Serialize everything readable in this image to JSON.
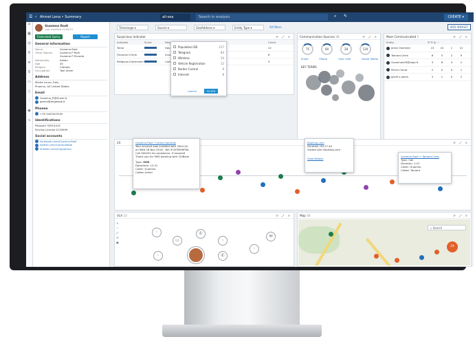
{
  "topbar": {
    "title": "Ahmet Lena • Summary",
    "scope": "all-sea",
    "search_placeholder": "Search in analysis",
    "create_label": "CREATE"
  },
  "profile": {
    "name": "Guamno Rodi",
    "sub": "Last modified 31/05/19",
    "btn_federated": "Federated Query",
    "btn_report": "Report",
    "general_title": "General information",
    "fields": [
      [
        "Name",
        "Guamno Rodi"
      ],
      [
        "Other Names",
        "Guamno P Rodi"
      ],
      [
        "",
        "Guamno P Ricardo"
      ],
      [
        "Nationality",
        "Italian"
      ],
      [
        "Age",
        "40"
      ],
      [
        "Religion",
        "Catholic"
      ],
      [
        "Occupation",
        "Taxi driver"
      ]
    ],
    "address_title": "Address",
    "address_lines": [
      "Monte Lauro, Italy",
      "Phoenix, AZ United States"
    ],
    "email_title": "Email",
    "emails": [
      "Guamno_R@Gmail.it",
      "gomio@angelook.it"
    ],
    "phones_title": "Phones",
    "phones": [
      "+39 3402003100"
    ],
    "ident_title": "Identifications",
    "idents": [
      "Passport 34914415",
      "Driving License 5134999"
    ],
    "social_title": "Social accounts",
    "socials": [
      "facebook.com/Guamno.Rodi",
      "twitter.com/GuamnoRodi",
      "linkedin.com/in/guamno"
    ]
  },
  "filters": {
    "timerange": "Timerange",
    "source": "Source",
    "geoaddress": "GeoAddress",
    "entity_type": "Entity Type",
    "link": "All filters",
    "add_widget": "ADD WIDGET"
  },
  "dropdown": {
    "items": [
      [
        "Population DB",
        "217"
      ],
      [
        "Telegram",
        "84"
      ],
      [
        "Wireless",
        "34"
      ],
      [
        "Vehicle Registration",
        "12"
      ],
      [
        "Border Control",
        "9"
      ],
      [
        "Internet",
        "8"
      ]
    ],
    "cancel": "Cancel",
    "filter": "FILTER"
  },
  "panel_indicators": {
    "title": "Suspicious Indicator",
    "head": [
      "Indicator",
      "Score",
      "Description",
      "Count"
    ],
    "rows": [
      [
        "Terror",
        "",
        "Has Arrested Sept. Name, ARREST SERVE-1",
        "12"
      ],
      [
        "Financial Crime",
        "",
        "Involved in Terrorists' Area in Sa-9 ard",
        "8"
      ],
      [
        "Religious Extremism",
        "",
        "Contact with Temple, Active Members",
        "5"
      ]
    ]
  },
  "panel_comms": {
    "title": "Communication Sources",
    "badge": "28",
    "gauges": [
      [
        "75",
        "Email"
      ],
      [
        "60",
        "Phone"
      ],
      [
        "28",
        "Over Ville"
      ],
      [
        "120",
        "Social Media"
      ]
    ],
    "key_terms": "KEY TERMS"
  },
  "panel_most": {
    "title": "Most Communicated",
    "badge": "5",
    "head": [
      "Entity"
    ],
    "rows": [
      [
        "Jemel Harmlee",
        "15",
        "24",
        "1",
        "12"
      ],
      [
        "Tamara Lileis",
        "8",
        "5",
        "2",
        "9"
      ],
      [
        "Guamnoe29@repo.it",
        "3",
        "6",
        "4",
        "2"
      ],
      [
        "Pierre Cenat",
        "2",
        "0",
        "5",
        "1"
      ],
      [
        "gachi's peers",
        "3",
        "1",
        "0",
        "2"
      ]
    ]
  },
  "timeline": {
    "popup1": {
      "link": "Guamno Rodi → Jemel Harmlee",
      "body": [
        "Your account was credited with 3500.00",
        "on Wed 28 Nov 2018 - Ref 3C5F8999FBA",
        "Call 900202 for assistance, if required",
        "Thank you for SMS banking with CitiBank"
      ],
      "type": "SMS",
      "date_time": "12:31",
      "caller": "Guamno",
      "callee": "Jemel"
    },
    "popup2": {
      "link": "Booking.com",
      "duration": "00:17:45",
      "visited": "Booking.com",
      "view": "View Details"
    },
    "popup3": {
      "link": "Guamno Rodi → Tamara Lileis",
      "type": "Call",
      "duration": "1:12",
      "caller": "Guamno",
      "callee": "Tamara"
    },
    "badge": "24"
  },
  "vla": {
    "title": "VLA",
    "badge": "23"
  },
  "map": {
    "title": "Map",
    "badge": "56",
    "search_placeholder": "Search",
    "cluster": "24"
  }
}
